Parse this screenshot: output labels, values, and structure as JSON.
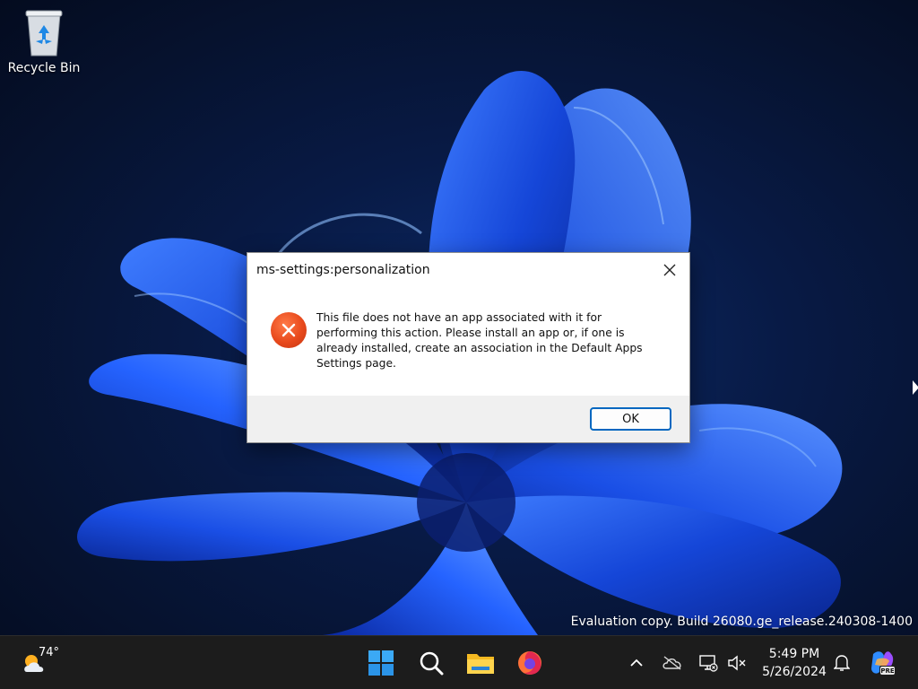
{
  "desktop": {
    "icons": [
      {
        "label": "Recycle Bin",
        "icon": "recycle-bin-icon"
      }
    ],
    "watermark": "Evaluation copy. Build 26080.ge_release.240308-1400"
  },
  "dialog": {
    "title": "ms-settings:personalization",
    "icon": "error-icon",
    "message": "This file does not have an app associated with it for performing this action. Please install an app or, if one is already installed, create an association in the Default Apps Settings page.",
    "ok_label": "OK"
  },
  "taskbar": {
    "weather": {
      "temp": "74°",
      "icon": "weather-icon"
    },
    "apps": [
      {
        "name": "start",
        "icon": "windows-start-icon"
      },
      {
        "name": "search",
        "icon": "search-icon"
      },
      {
        "name": "file-explorer",
        "icon": "folder-icon"
      },
      {
        "name": "firefox",
        "icon": "firefox-icon"
      }
    ],
    "tray": {
      "icons": [
        "chevron-up-icon",
        "cloud-offline-icon",
        "network-icon",
        "volume-muted-icon",
        "bell-icon",
        "copilot-icon"
      ],
      "time": "5:49 PM",
      "date": "5/26/2024",
      "copilot_badge": "PRE"
    }
  },
  "colors": {
    "accent": "#0067c0",
    "error": "#e8491c",
    "taskbar": "#1c1c1c"
  }
}
